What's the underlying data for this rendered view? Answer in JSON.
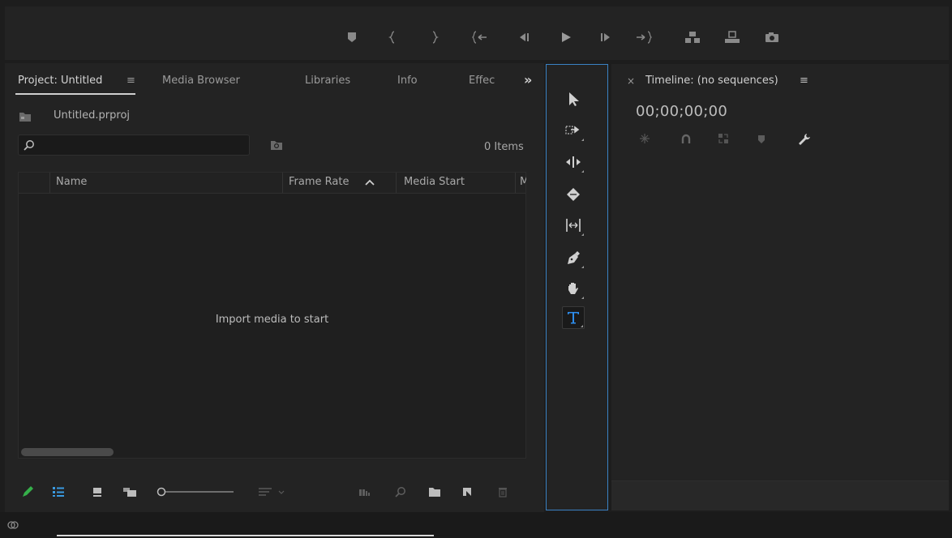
{
  "project_panel": {
    "tabs": [
      {
        "label": "Project: Untitled",
        "active": true
      },
      {
        "label": "Media Browser"
      },
      {
        "label": "Libraries"
      },
      {
        "label": "Info"
      },
      {
        "label": "Effec"
      }
    ],
    "overflow_label": "»",
    "menu_label": "≡",
    "project_file": "Untitled.prproj",
    "search": {
      "value": "",
      "placeholder": ""
    },
    "item_count": "0 Items",
    "columns": [
      "Name",
      "Frame Rate",
      "Media Start",
      "M"
    ],
    "sort_indicator": "^",
    "empty_message": "Import media to start",
    "bottom_icons": [
      "pencil-icon",
      "list-view-icon",
      "icon-view-icon",
      "freeform-view-icon",
      "zoom-slider-icon",
      "sort-icon",
      "automate-icon",
      "find-icon",
      "new-bin-icon",
      "new-item-icon",
      "trash-icon"
    ]
  },
  "transport_controls": [
    "add-marker-icon",
    "mark-in-icon",
    "mark-out-icon",
    "go-to-in-icon",
    "step-back-icon",
    "play-icon",
    "step-forward-icon",
    "go-to-out-icon",
    "lift-icon",
    "extract-icon",
    "export-frame-icon"
  ],
  "tools": [
    "selection-tool-icon",
    "track-select-tool-icon",
    "ripple-edit-tool-icon",
    "razor-tool-icon",
    "slip-tool-icon",
    "pen-tool-icon",
    "hand-tool-icon",
    "type-tool-icon"
  ],
  "active_tool": "type-tool-icon",
  "timeline_panel": {
    "close_label": "×",
    "title": "Timeline: (no sequences)",
    "menu_label": "≡",
    "timecode": "00;00;00;00",
    "toolbar_icons": [
      "insert-nest-icon",
      "snap-magnet-icon",
      "linked-selection-icon",
      "add-marker-icon",
      "wrench-icon"
    ]
  },
  "colors": {
    "accent": "#3a82c4",
    "type_tool": "#2d8ceb",
    "pencil": "#35b04a",
    "list_view": "#3a9ae0"
  }
}
